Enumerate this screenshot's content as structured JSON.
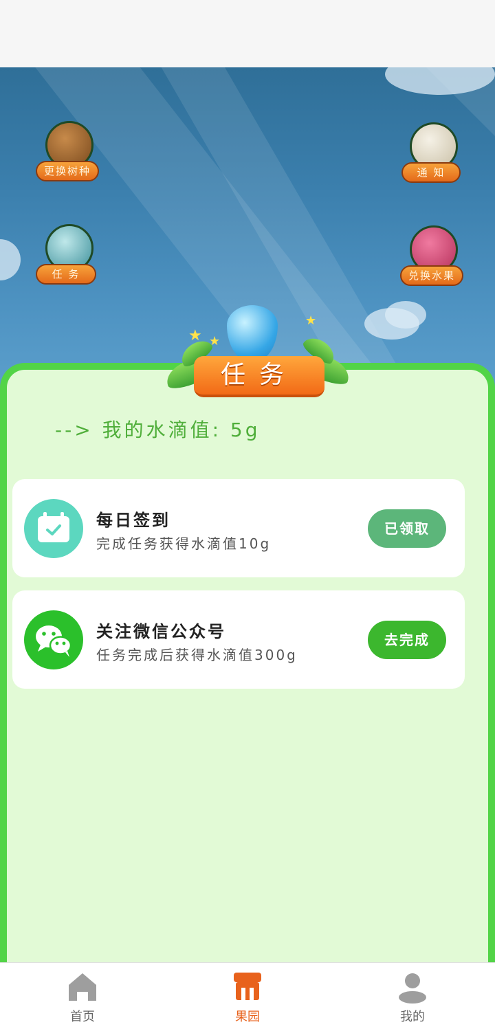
{
  "game": {
    "change_seed_label": "更换树种",
    "notice_label": "通 知",
    "task_label": "任 务",
    "exchange_fruit_label": "兑换水果"
  },
  "panel": {
    "banner_title": "任务",
    "water_prefix": "--> 我的水滴值:",
    "water_value": "5g"
  },
  "tasks": [
    {
      "icon": "calendar-check-icon",
      "title": "每日签到",
      "description": "完成任务获得水滴值10g",
      "action": "已领取",
      "icon_color": "#5cd7bf",
      "action_color": "#5cb67a"
    },
    {
      "icon": "wechat-icon",
      "title": "关注微信公众号",
      "description": "任务完成后获得水滴值300g",
      "action": "去完成",
      "icon_color": "#2bc02b",
      "action_color": "#3cb72e"
    }
  ],
  "nav": {
    "items": [
      {
        "label": "首页",
        "icon": "home-icon",
        "active": false
      },
      {
        "label": "果园",
        "icon": "shop-icon",
        "active": true
      },
      {
        "label": "我的",
        "icon": "user-icon",
        "active": false
      }
    ],
    "active_color": "#e8621c",
    "inactive_color": "#9e9e9e"
  }
}
